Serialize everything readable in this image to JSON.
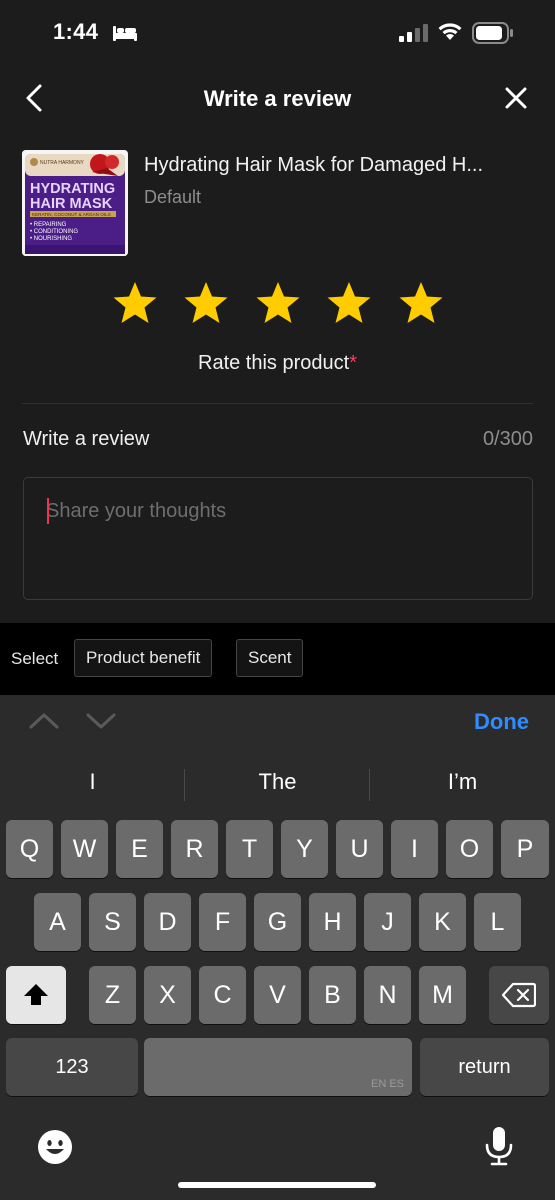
{
  "status_bar": {
    "time": "1:44"
  },
  "nav": {
    "title": "Write a review"
  },
  "product": {
    "name": "Hydrating Hair Mask for Damaged H...",
    "variant": "Default",
    "thumb_brand": "NUTRA HARMONY",
    "thumb_title_1": "HYDRATING",
    "thumb_title_2": "HAIR MASK",
    "thumb_sub": "KERATIN, COCONUT & ARGAN OILS",
    "thumb_bullets": [
      "• REPAIRING",
      "• CONDITIONING",
      "• NOURISHING"
    ]
  },
  "rating": {
    "value": 5,
    "max": 5,
    "label": "Rate this product",
    "required_mark": "*"
  },
  "review": {
    "heading": "Write a review",
    "count": "0/300",
    "placeholder": "Share your thoughts",
    "value": ""
  },
  "select_bar": {
    "label": "Select",
    "chips": [
      "Product benefit",
      "Scent"
    ]
  },
  "keyboard": {
    "done_label": "Done",
    "suggestions": [
      "I",
      "The",
      "I’m"
    ],
    "row1": [
      "Q",
      "W",
      "E",
      "R",
      "T",
      "Y",
      "U",
      "I",
      "O",
      "P"
    ],
    "row2": [
      "A",
      "S",
      "D",
      "F",
      "G",
      "H",
      "J",
      "K",
      "L"
    ],
    "row3": [
      "Z",
      "X",
      "C",
      "V",
      "B",
      "N",
      "M"
    ],
    "numbers_label": "123",
    "space_lang": "EN ES",
    "return_label": "return"
  },
  "colors": {
    "accent": "#2f8cff",
    "star": "#ffcc00",
    "required": "#ff3b5c",
    "caret": "#e8374f"
  }
}
